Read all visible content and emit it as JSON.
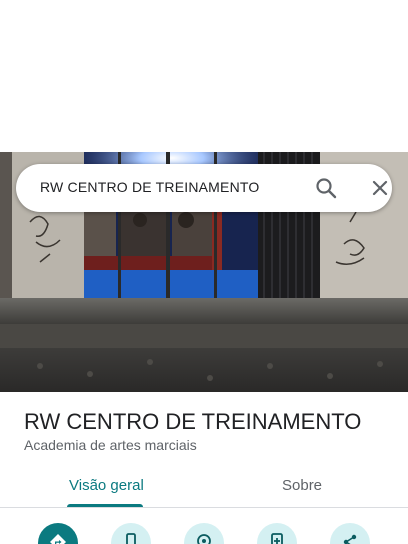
{
  "search": {
    "query": "RW CENTRO DE TREINAMENTO"
  },
  "place": {
    "name": "RW CENTRO DE TREINAMENTO",
    "category": "Academia de artes marciais"
  },
  "tabs": [
    {
      "label": "Visão geral",
      "active": true
    },
    {
      "label": "Sobre",
      "active": false
    }
  ],
  "actions": [
    {
      "icon": "directions-icon"
    },
    {
      "icon": "phone-icon"
    },
    {
      "icon": "location-icon"
    },
    {
      "icon": "add-to-phone-icon"
    },
    {
      "icon": "share-icon"
    }
  ],
  "colors": {
    "accent": "#0b7a80",
    "accent_light": "#d4f0f2",
    "text_primary": "#202124",
    "text_secondary": "#5f6368"
  }
}
